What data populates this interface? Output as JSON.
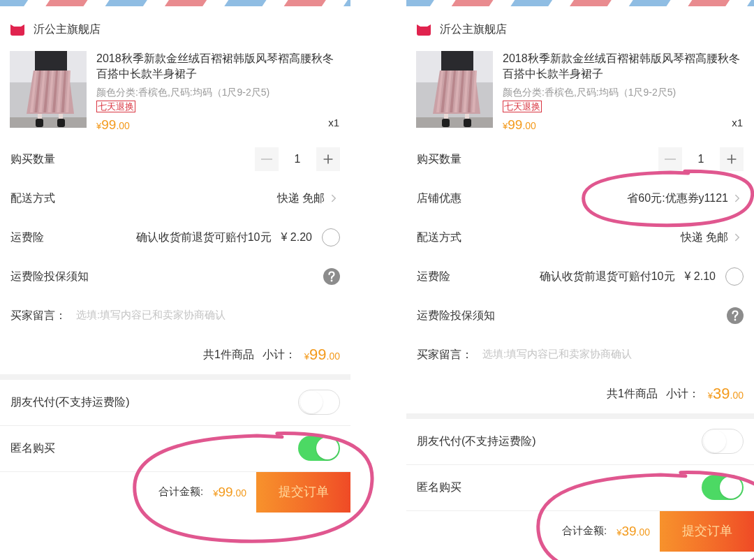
{
  "panels": [
    {
      "store": {
        "name": "沂公主旗舰店"
      },
      "product": {
        "title": "2018秋季新款金丝绒百褶裙韩版风琴褶高腰秋冬百搭中长款半身裙子",
        "variant": "颜色分类:香槟色,尺码:均码（1尺9-2尺5)",
        "tag": "七天退换",
        "price": {
          "symbol": "¥",
          "integer": "99",
          "decimal": ".00"
        },
        "quantity": "x1"
      },
      "rows": [
        {
          "kind": "stepper",
          "label": "购买数量",
          "count": "1"
        },
        {
          "kind": "option",
          "label": "配送方式",
          "value": "快递 免邮",
          "circled": false
        },
        {
          "kind": "insurance",
          "label": "运费险",
          "note": "确认收货前退货可赔付10元",
          "price": "¥ 2.20",
          "checked": false
        },
        {
          "kind": "help",
          "label": "运费险投保须知"
        },
        {
          "kind": "message",
          "label": "买家留言：",
          "placeholder": "选填:填写内容已和卖家协商确认"
        },
        {
          "kind": "subtotal",
          "count_text": "共1件商品",
          "label": "小计：",
          "price": {
            "symbol": "¥",
            "integer": "99",
            "decimal": ".00"
          }
        }
      ],
      "toggles": [
        {
          "label": "朋友代付(不支持运费险)",
          "on": false
        },
        {
          "label": "匿名购买",
          "on": true
        }
      ],
      "footer": {
        "label": "合计金额:",
        "price": {
          "symbol": "¥",
          "integer": "99",
          "decimal": ".00"
        },
        "button": "提交订单",
        "circled": true
      }
    },
    {
      "store": {
        "name": "沂公主旗舰店"
      },
      "product": {
        "title": "2018秋季新款金丝绒百褶裙韩版风琴褶高腰秋冬百搭中长款半身裙子",
        "variant": "颜色分类:香槟色,尺码:均码（1尺9-2尺5)",
        "tag": "七天退换",
        "price": {
          "symbol": "¥",
          "integer": "99",
          "decimal": ".00"
        },
        "quantity": "x1"
      },
      "rows": [
        {
          "kind": "stepper",
          "label": "购买数量",
          "count": "1"
        },
        {
          "kind": "option",
          "label": "店铺优惠",
          "value": "省60元:优惠券y1121",
          "circled": true
        },
        {
          "kind": "option",
          "label": "配送方式",
          "value": "快递 免邮",
          "circled": false
        },
        {
          "kind": "insurance",
          "label": "运费险",
          "note": "确认收货前退货可赔付10元",
          "price": "¥ 2.10",
          "checked": false
        },
        {
          "kind": "help",
          "label": "运费险投保须知"
        },
        {
          "kind": "message",
          "label": "买家留言：",
          "placeholder": "选填:填写内容已和卖家协商确认"
        },
        {
          "kind": "subtotal",
          "count_text": "共1件商品",
          "label": "小计：",
          "price": {
            "symbol": "¥",
            "integer": "39",
            "decimal": ".00"
          }
        }
      ],
      "toggles": [
        {
          "label": "朋友代付(不支持运费险)",
          "on": false
        },
        {
          "label": "匿名购买",
          "on": true
        }
      ],
      "footer": {
        "label": "合计金额:",
        "price": {
          "symbol": "¥",
          "integer": "39",
          "decimal": ".00"
        },
        "button": "提交订单",
        "circled": true
      }
    }
  ]
}
